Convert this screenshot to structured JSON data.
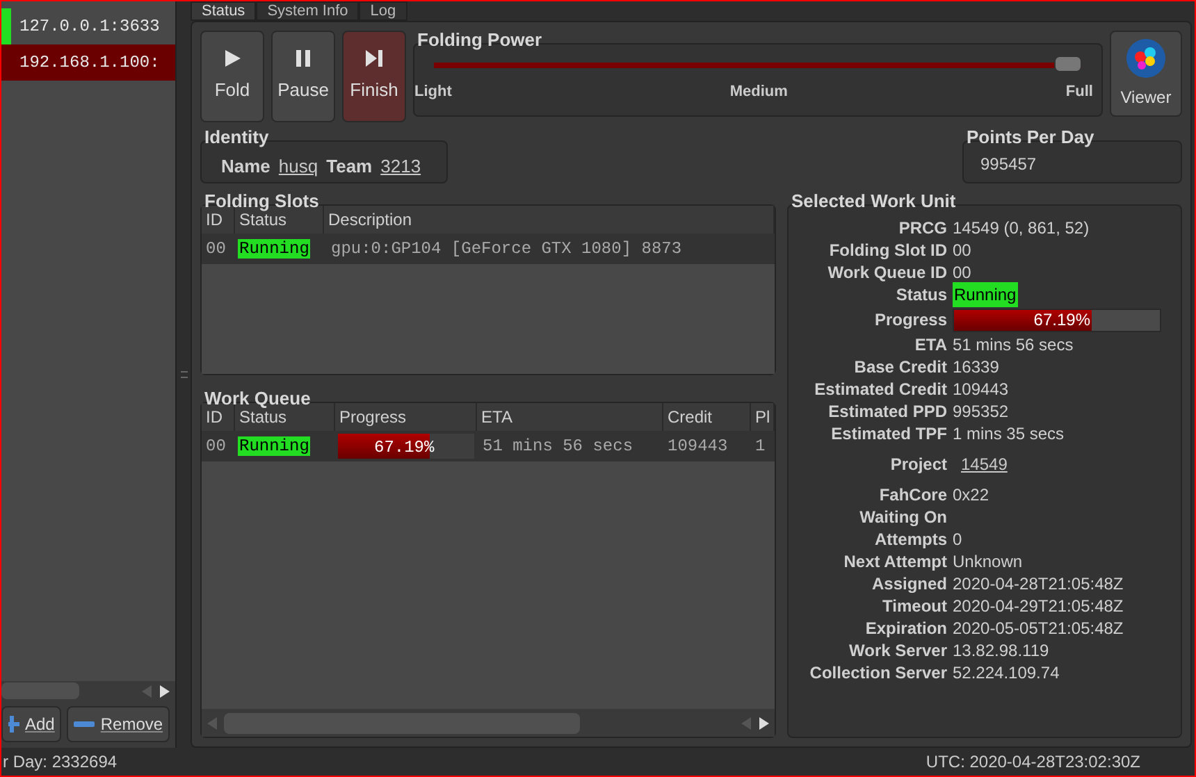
{
  "clients": [
    {
      "address": "127.0.0.1:3633",
      "color": "#22dd22"
    },
    {
      "address": "192.168.1.100:",
      "color": "#6b0000"
    }
  ],
  "client_buttons": [
    {
      "kind": "add",
      "label": "Add"
    },
    {
      "kind": "remove",
      "label": "Remove"
    }
  ],
  "tabs": [
    {
      "label": "Status",
      "selected": true
    },
    {
      "label": "System Info",
      "selected": false
    },
    {
      "label": "Log",
      "selected": false
    }
  ],
  "actions": [
    {
      "kind": "fold",
      "label": "Fold",
      "selected": false
    },
    {
      "kind": "pause",
      "label": "Pause",
      "selected": false
    },
    {
      "kind": "finish",
      "label": "Finish",
      "selected": true
    }
  ],
  "folding_power": {
    "title": "Folding Power",
    "level": 1,
    "labels": [
      "Light",
      "Medium",
      "Full"
    ]
  },
  "viewer": {
    "label": "Viewer"
  },
  "identity": {
    "title": "Identity",
    "name_label": "Name",
    "name": "husq",
    "team_label": "Team",
    "team": "3213"
  },
  "ppd": {
    "title": "Points Per Day",
    "value": "995457"
  },
  "folding_slots": {
    "title": "Folding Slots",
    "columns": [
      "ID",
      "Status",
      "Description"
    ],
    "rows": [
      {
        "id": "00",
        "status": "Running",
        "description": "gpu:0:GP104 [GeForce GTX 1080] 8873"
      }
    ]
  },
  "work_queue": {
    "title": "Work Queue",
    "columns": [
      "ID",
      "Status",
      "Progress",
      "ETA",
      "Credit",
      "Pl"
    ],
    "rows": [
      {
        "id": "00",
        "status": "Running",
        "progress": "67.19%",
        "level": 0.6719,
        "eta": "51 mins 56 secs",
        "credit": "109443",
        "column_6": "1"
      }
    ]
  },
  "work_unit": {
    "title": "Selected Work Unit",
    "fields": [
      {
        "kind": "text",
        "label": "PRCG",
        "value": "14549 (0, 861, 52)"
      },
      {
        "kind": "text",
        "label": "Folding Slot ID",
        "value": "00"
      },
      {
        "kind": "text",
        "label": "Work Queue ID",
        "value": "00"
      },
      {
        "kind": "status",
        "label": "Status",
        "value": "Running"
      },
      {
        "kind": "progress",
        "label": "Progress",
        "value": "67.19%",
        "level": 0.6719
      },
      {
        "kind": "text",
        "label": "ETA",
        "value": "51 mins 56 secs"
      },
      {
        "kind": "text",
        "label": "Base Credit",
        "value": "16339"
      },
      {
        "kind": "text",
        "label": "Estimated Credit",
        "value": "109443"
      },
      {
        "kind": "text",
        "label": "Estimated PPD",
        "value": "995352"
      },
      {
        "kind": "text",
        "label": "Estimated TPF",
        "value": "1 mins 35 secs"
      },
      {
        "kind": "link",
        "label": "Project",
        "value": "14549"
      },
      {
        "kind": "text",
        "label": "FahCore",
        "value": "0x22"
      },
      {
        "kind": "text",
        "label": "Waiting On"
      },
      {
        "kind": "text",
        "label": "Attempts",
        "value": "0"
      },
      {
        "kind": "text",
        "label": "Next Attempt",
        "value": "Unknown"
      },
      {
        "kind": "text",
        "label": "Assigned",
        "value": "2020-04-28T21:05:48Z"
      },
      {
        "kind": "text",
        "label": "Timeout",
        "value": "2020-04-29T21:05:48Z"
      },
      {
        "kind": "text",
        "label": "Expiration",
        "value": "2020-05-05T21:05:48Z"
      },
      {
        "kind": "text",
        "label": "Work Server",
        "value": "13.82.98.119"
      },
      {
        "kind": "text",
        "label": "Collection Server",
        "value": "52.224.109.74"
      }
    ]
  },
  "status_bar": {
    "left": "r Day: 2332694",
    "right": "UTC: 2020-04-28T23:02:30Z"
  }
}
